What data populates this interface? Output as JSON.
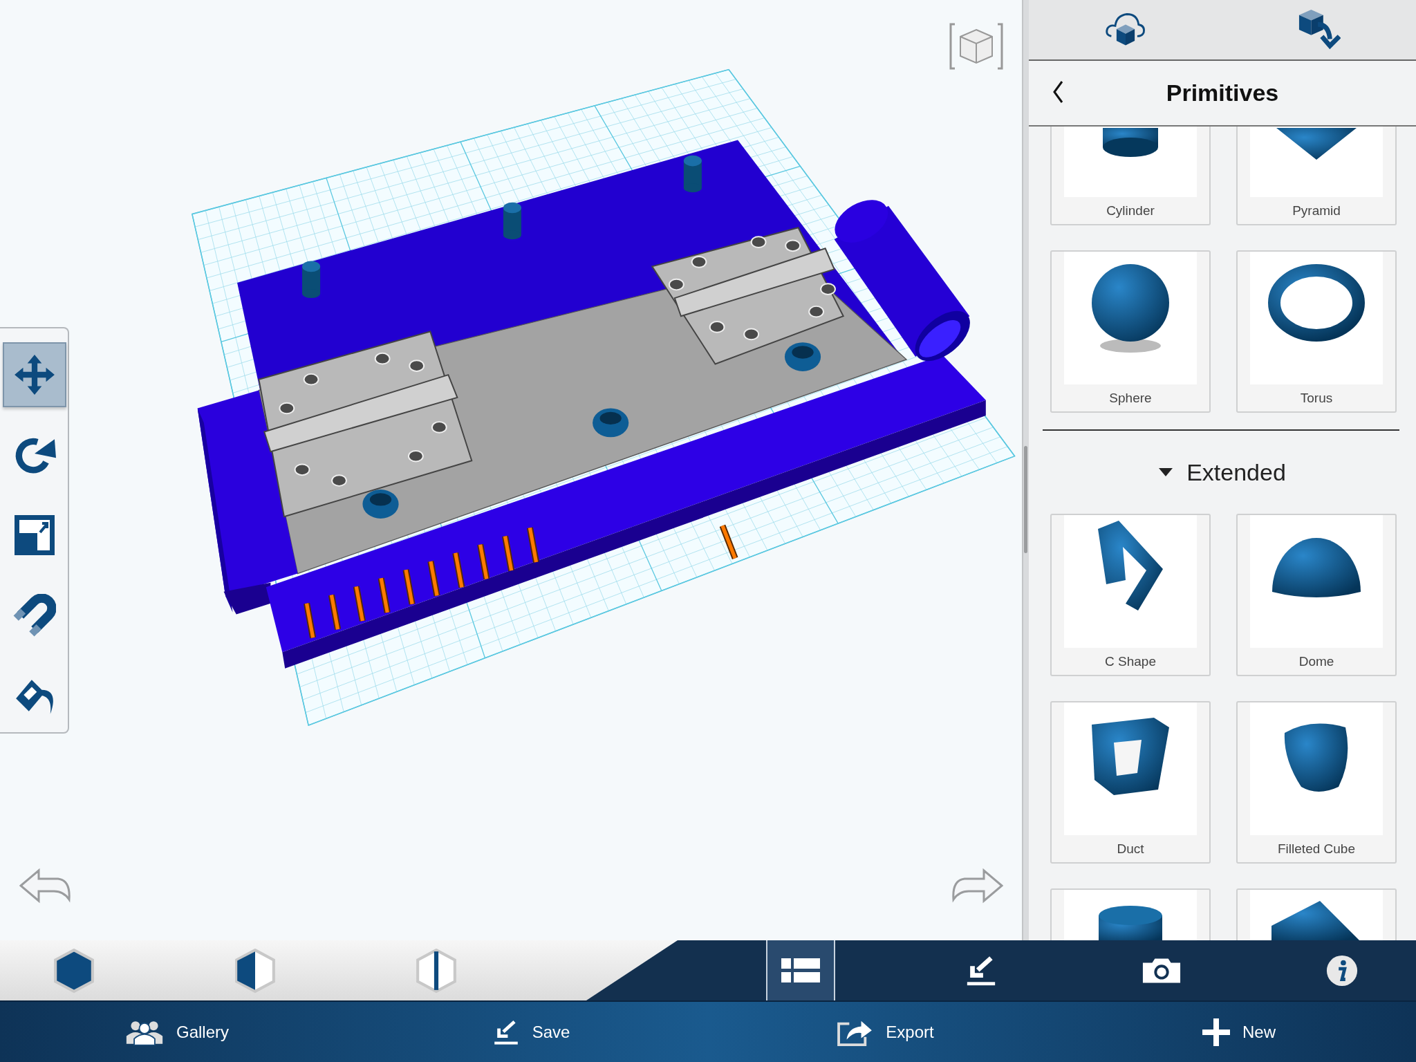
{
  "tools": [
    {
      "kind": "move",
      "selected": true
    },
    {
      "kind": "rotate",
      "selected": false
    },
    {
      "kind": "scale",
      "selected": false
    },
    {
      "kind": "snap",
      "selected": false
    },
    {
      "kind": "material",
      "selected": false
    }
  ],
  "panel": {
    "title": "Primitives",
    "primitives": [
      {
        "label": "Cylinder",
        "kind": "cylinder"
      },
      {
        "label": "Pyramid",
        "kind": "pyramid"
      },
      {
        "label": "Sphere",
        "kind": "sphere"
      },
      {
        "label": "Torus",
        "kind": "torus"
      }
    ],
    "section": {
      "title": "Extended",
      "expanded": true
    },
    "extended": [
      {
        "label": "C Shape",
        "kind": "cshape"
      },
      {
        "label": "Dome",
        "kind": "dome"
      },
      {
        "label": "Duct",
        "kind": "duct"
      },
      {
        "label": "Filleted Cube",
        "kind": "filleted-cube"
      },
      {
        "kind": "cylinder-top"
      },
      {
        "kind": "wedge"
      }
    ]
  },
  "view_modes": [
    {
      "kind": "solid"
    },
    {
      "kind": "half"
    },
    {
      "kind": "outline"
    }
  ],
  "tabs": [
    {
      "kind": "list",
      "selected": true
    },
    {
      "kind": "download",
      "selected": false
    },
    {
      "kind": "camera",
      "selected": false
    },
    {
      "kind": "info",
      "selected": false
    }
  ],
  "nav": [
    {
      "label": "Gallery",
      "kind": "gallery"
    },
    {
      "label": "Save",
      "kind": "save"
    },
    {
      "label": "Export",
      "kind": "export"
    },
    {
      "label": "New",
      "kind": "new"
    }
  ]
}
